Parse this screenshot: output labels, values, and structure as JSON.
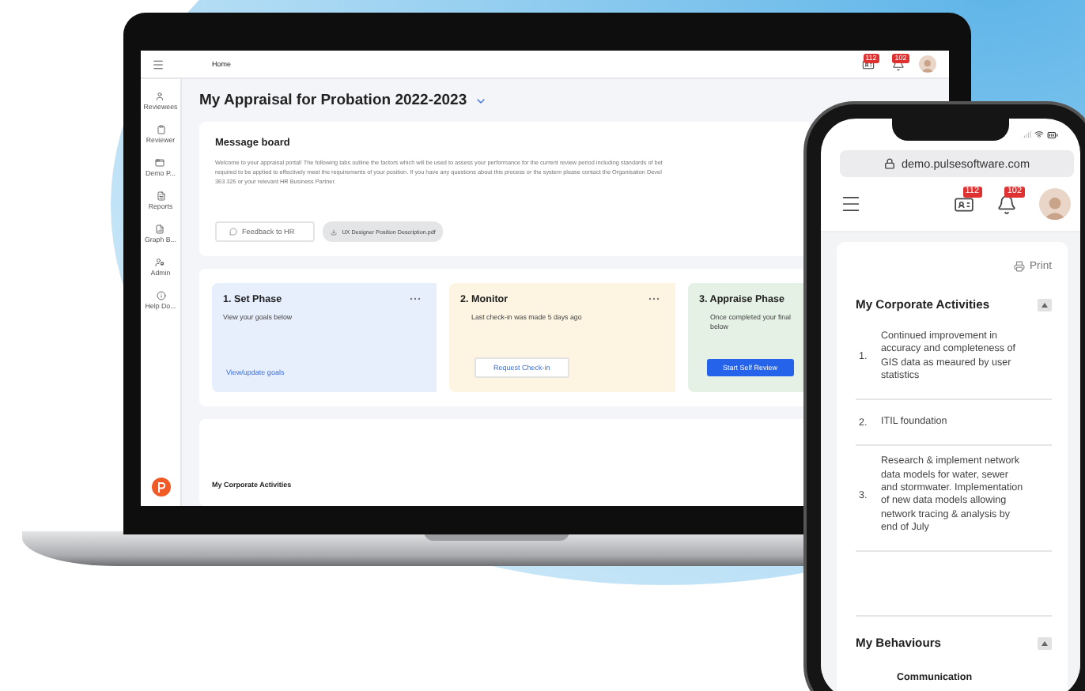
{
  "laptop": {
    "topbar": {
      "breadcrumb": "Home",
      "badges": [
        {
          "kind": "id-card",
          "count": "112"
        },
        {
          "kind": "bell",
          "count": "102"
        }
      ]
    },
    "sidebar": {
      "items": [
        {
          "kind": "user",
          "label": "Reviewees"
        },
        {
          "kind": "clipboard",
          "label": "Reviewer"
        },
        {
          "kind": "window",
          "label": "Demo P..."
        },
        {
          "kind": "file",
          "label": "Reports"
        },
        {
          "kind": "chart",
          "label": "Graph B..."
        },
        {
          "kind": "admin",
          "label": "Admin"
        },
        {
          "kind": "info",
          "label": "Help Do..."
        }
      ]
    },
    "page_title": "My Appraisal for Probation 2022-2023",
    "message_board": {
      "title": "Message board",
      "lines": [
        "Welcome to your appraisal portal! The following tabs outline the factors which will be used to assess your performance for the current review period including standards of bet",
        "required to be applied to effectively meet the requirements of your position. If you have any questions about this process or the system please contact the Organisation Devel",
        "363 325 or your relevant HR Business Partner."
      ],
      "buttons": [
        {
          "kind": "feedback",
          "label": "Feedback to HR"
        },
        {
          "kind": "download",
          "label": "UX Designer Position Description.pdf"
        }
      ]
    },
    "phases": [
      {
        "title": "1. Set Phase",
        "color": "#e7eefc",
        "menu": true,
        "lines": [
          "View your goals below"
        ],
        "action": {
          "kind": "link",
          "label": "View/update goals"
        }
      },
      {
        "title": "2. Monitor",
        "color": "#fdf5e2",
        "menu": true,
        "lines": [
          "Last check-in was made 5 days ago"
        ],
        "action": {
          "kind": "outline",
          "label": "Request Check-in"
        }
      },
      {
        "title": "3. Appraise Phase",
        "color": "#e5f1e4",
        "menu": false,
        "lines": [
          "Once completed your final",
          "below"
        ],
        "action": {
          "kind": "primary",
          "label": "Start Self Review"
        }
      }
    ],
    "bottom_card": {
      "title": "My Corporate Activities"
    }
  },
  "phone": {
    "url": "demo.pulsesoftware.com",
    "badges": [
      {
        "kind": "id-card",
        "count": "112"
      },
      {
        "kind": "bell",
        "count": "102"
      }
    ],
    "print": "Print",
    "sections": [
      {
        "title": "My Corporate Activities",
        "expanded": true,
        "items": [
          {
            "number": "1.",
            "text": "Continued improvement in accuracy and completeness of GIS data as meaured by user statistics"
          },
          {
            "number": "2.",
            "text": "ITIL foundation"
          },
          {
            "number": "3.",
            "text": "Research & implement network data models for water, sewer and stormwater. Implementation of new data models allowing network tracing & analysis by end of July"
          }
        ]
      },
      {
        "title": "My Behaviours",
        "expanded": true,
        "subheading": "Communication"
      }
    ]
  }
}
